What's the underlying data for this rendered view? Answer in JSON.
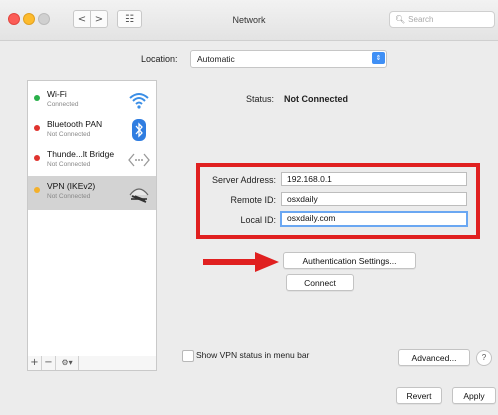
{
  "window": {
    "title": "Network",
    "search_placeholder": "Search",
    "nav_back": "<",
    "nav_forward": ">",
    "grid_glyph": "☷"
  },
  "location": {
    "label": "Location:",
    "value": "Automatic"
  },
  "services": [
    {
      "name": "Wi-Fi",
      "status": "Connected",
      "dot_color": "#2ab04a",
      "icon": "wifi-icon"
    },
    {
      "name": "Bluetooth PAN",
      "status": "Not Connected",
      "dot_color": "#e0332e",
      "icon": "bluetooth-icon"
    },
    {
      "name": "Thunde...lt Bridge",
      "status": "Not Connected",
      "dot_color": "#e0332e",
      "icon": "thunderbolt-bridge-icon"
    },
    {
      "name": "VPN (IKEv2)",
      "status": "Not Connected",
      "dot_color": "#f3b02b",
      "icon": "vpn-icon"
    }
  ],
  "sidebar_footer": {
    "add": "+",
    "remove": "−",
    "gear": "⚙▾"
  },
  "detail": {
    "status_label": "Status:",
    "status_value": "Not Connected",
    "server_address_label": "Server Address:",
    "server_address_value": "192.168.0.1",
    "remote_id_label": "Remote ID:",
    "remote_id_value": "osxdaily",
    "local_id_label": "Local ID:",
    "local_id_value": "osxdaily.com",
    "auth_button": "Authentication Settings...",
    "connect_button": "Connect",
    "show_status_label": "Show VPN status in menu bar",
    "show_status_checked": false,
    "advanced_button": "Advanced...",
    "help_button": "?"
  },
  "footer": {
    "revert": "Revert",
    "apply": "Apply"
  },
  "annotation_color": "#e02020"
}
